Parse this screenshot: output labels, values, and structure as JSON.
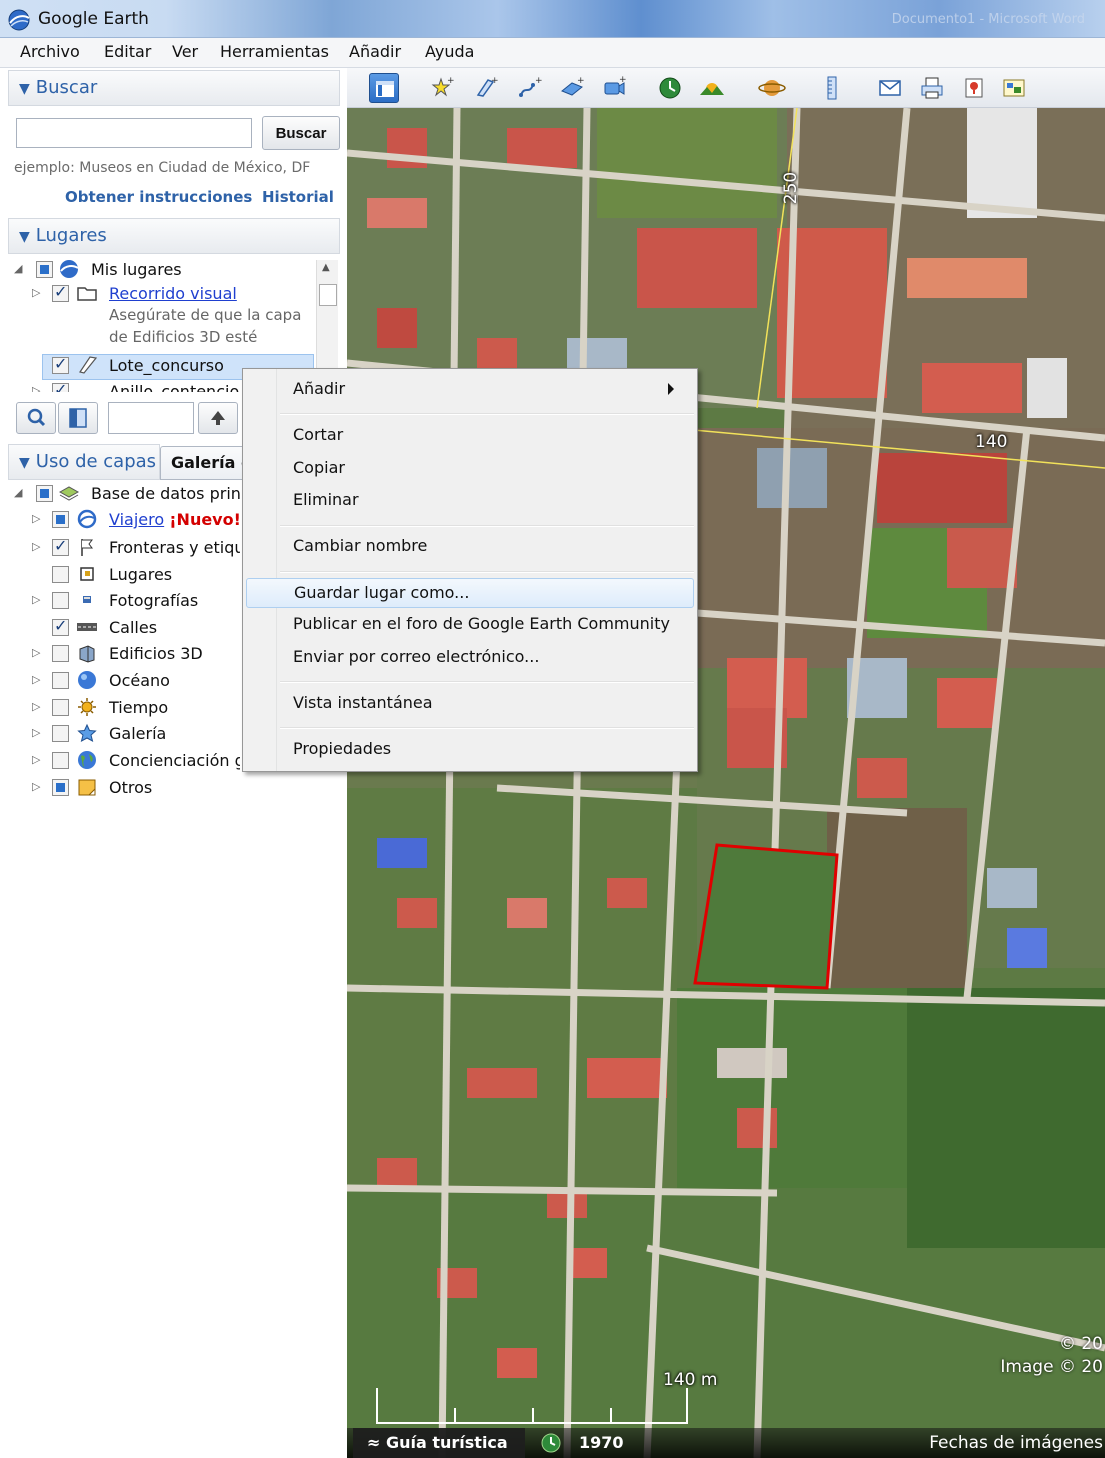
{
  "window": {
    "title": "Google Earth",
    "background_title": "Documento1 - Microsoft Word"
  },
  "menu": [
    "Archivo",
    "Editar",
    "Ver",
    "Herramientas",
    "Añadir",
    "Ayuda"
  ],
  "search": {
    "heading": "Buscar",
    "button": "Buscar",
    "example": "ejemplo: Museos en Ciudad de México, DF",
    "link_directions": "Obtener instrucciones",
    "link_history": "Historial"
  },
  "places": {
    "heading": "Lugares",
    "items": [
      {
        "label": "Mis lugares"
      },
      {
        "label": "Recorrido visual",
        "description_1": "Asegúrate de que la capa",
        "description_2": "de Edificios 3D esté"
      },
      {
        "label": "Lote_concurso"
      },
      {
        "label": "Anillo_contencion"
      }
    ]
  },
  "layers": {
    "heading": "Uso de capas",
    "tab_gallery": "Galería de Earth",
    "root": "Base de datos principal",
    "items": [
      {
        "label": "Viajero",
        "badge": "¡Nuevo!"
      },
      {
        "label": "Fronteras y etiquetas"
      },
      {
        "label": "Lugares"
      },
      {
        "label": "Fotografías"
      },
      {
        "label": "Calles"
      },
      {
        "label": "Edificios 3D"
      },
      {
        "label": "Océano"
      },
      {
        "label": "Tiempo"
      },
      {
        "label": "Galería"
      },
      {
        "label": "Concienciación global"
      },
      {
        "label": "Otros"
      }
    ]
  },
  "context_menu": {
    "items": [
      {
        "label": "Añadir",
        "submenu": true
      },
      {
        "label": "Cortar"
      },
      {
        "label": "Copiar"
      },
      {
        "label": "Eliminar"
      },
      {
        "label": "Cambiar nombre"
      },
      {
        "label": "Guardar lugar como...",
        "highlighted": true
      },
      {
        "label": "Publicar en el foro de Google Earth Community"
      },
      {
        "label": "Enviar por correo electrónico..."
      },
      {
        "label": "Vista instantánea"
      },
      {
        "label": "Propiedades"
      }
    ]
  },
  "map": {
    "road_label_1": "250",
    "road_label_2": "140",
    "scale_label": "140 m",
    "copyright_1": "© 20",
    "copyright_2": "Image © 20",
    "tour_guide": "Guía turística",
    "year": "1970",
    "imagery_dates": "Fechas de imágenes"
  },
  "colors": {
    "link": "#1f3fcf",
    "heading": "#2e62a8",
    "new_badge": "#d40000",
    "polygon": "#e00000"
  }
}
